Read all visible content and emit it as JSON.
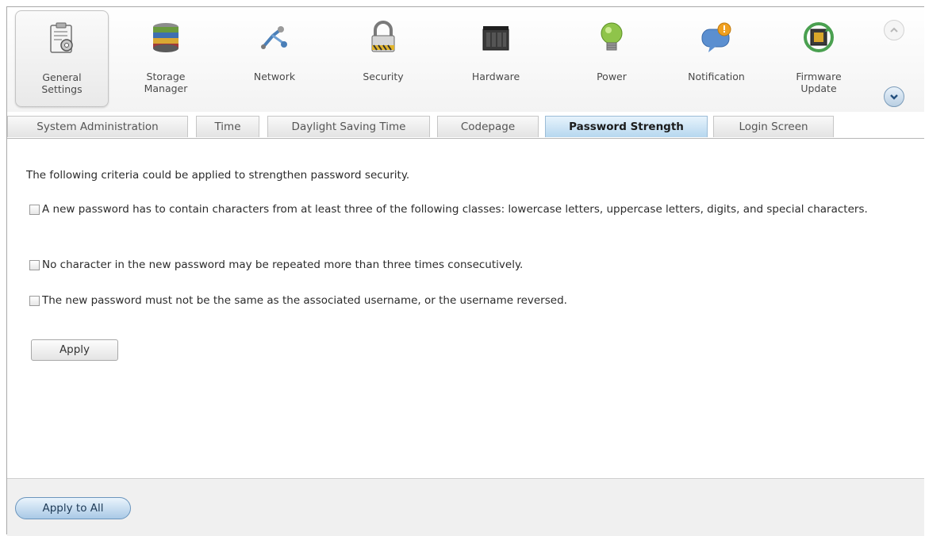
{
  "apps": [
    {
      "label": "General\nSettings",
      "icon": "general-settings-icon",
      "selected": true
    },
    {
      "label": "Storage\nManager",
      "icon": "storage-manager-icon"
    },
    {
      "label": "Network",
      "icon": "network-icon"
    },
    {
      "label": "Security",
      "icon": "security-lock-icon"
    },
    {
      "label": "Hardware",
      "icon": "hardware-icon"
    },
    {
      "label": "Power",
      "icon": "power-bulb-icon"
    },
    {
      "label": "Notification",
      "icon": "notification-icon"
    },
    {
      "label": "Firmware\nUpdate",
      "icon": "firmware-update-icon"
    }
  ],
  "nav": {
    "up_icon": "chevron-up-icon",
    "down_icon": "chevron-down-icon"
  },
  "tabs": [
    {
      "label": "System Administration"
    },
    {
      "label": "Time"
    },
    {
      "label": "Daylight Saving Time"
    },
    {
      "label": "Codepage"
    },
    {
      "label": "Password Strength",
      "active": true
    },
    {
      "label": "Login Screen"
    }
  ],
  "content": {
    "intro": "The following criteria could be applied to strengthen password security.",
    "criteria": [
      {
        "text": "A new password has to contain characters from at least three of the following classes: lowercase letters, uppercase letters, digits, and special characters.",
        "checked": false
      },
      {
        "text": "No character in the new password may be repeated more than three times consecutively.",
        "checked": false
      },
      {
        "text": "The new password must not be the same as the associated username, or the username reversed.",
        "checked": false
      }
    ],
    "apply_label": "Apply"
  },
  "footer": {
    "apply_all_label": "Apply to All"
  },
  "colors": {
    "active_tab": "#b6d7ef",
    "accent_blue": "#6b95bd",
    "frame_border": "#a9a9a9"
  }
}
